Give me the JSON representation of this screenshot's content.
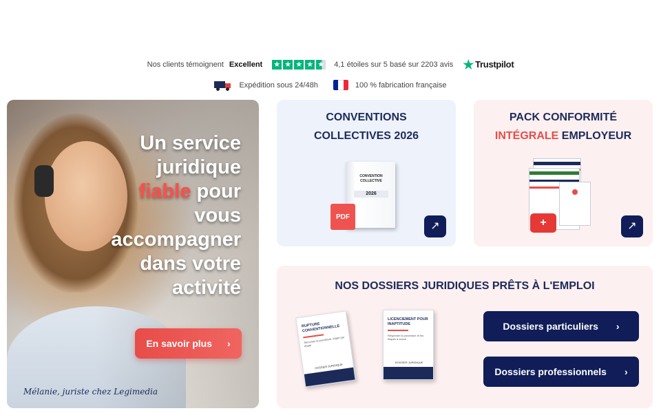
{
  "trust": {
    "prefix": "Nos clients témoignent",
    "rating_word": "Excellent",
    "stars": "4.1",
    "rating_text": "4,1 étoiles sur 5 basé sur 2203 avis",
    "brand": "Trustpilot"
  },
  "shipping": {
    "delivery": "Expédition sous 24/48h",
    "origin": "100 % fabrication française",
    "flag_colors": [
      "#002395",
      "#ffffff",
      "#ed2939"
    ]
  },
  "hero": {
    "line1": "Un service",
    "line2": "juridique",
    "accent": "fiable",
    "line3_rest": " pour",
    "line4": "vous",
    "line5": "accompagner",
    "line6": "dans votre",
    "line7": "activité",
    "cta": "En savoir plus",
    "signature": "Mélanie, juriste chez Legimedia"
  },
  "cards": {
    "conventions": {
      "title_line1": "CONVENTIONS",
      "title_line2": "COLLECTIVES 2026",
      "book_title": "CONVENTION COLLECTIVE",
      "book_year": "2026",
      "badge": "PDF"
    },
    "pack": {
      "title_line1": "PACK CONFORMITÉ",
      "title_red": "INTÉGRALE",
      "title_rest": " EMPLOYEUR"
    },
    "dossiers": {
      "title": "NOS DOSSIERS JURIDIQUES PRÊTS À L'EMPLOI",
      "book1_title": "RUPTURE CONVENTIONNELLE",
      "book1_sub": "Sécuriser la procédure, étape par étape",
      "book2_title": "LICENCIEMENT POUR INAPTITUDE",
      "book2_sub": "Respecter la procédure et les étapes à suivre",
      "book_footer": "DOSSIER JURIDIQUE",
      "btn_particuliers": "Dossiers particuliers",
      "btn_professionnels": "Dossiers professionnels"
    }
  },
  "colors": {
    "navy": "#101d58",
    "accent_red": "#e84c48",
    "trustpilot_green": "#00b67a"
  }
}
